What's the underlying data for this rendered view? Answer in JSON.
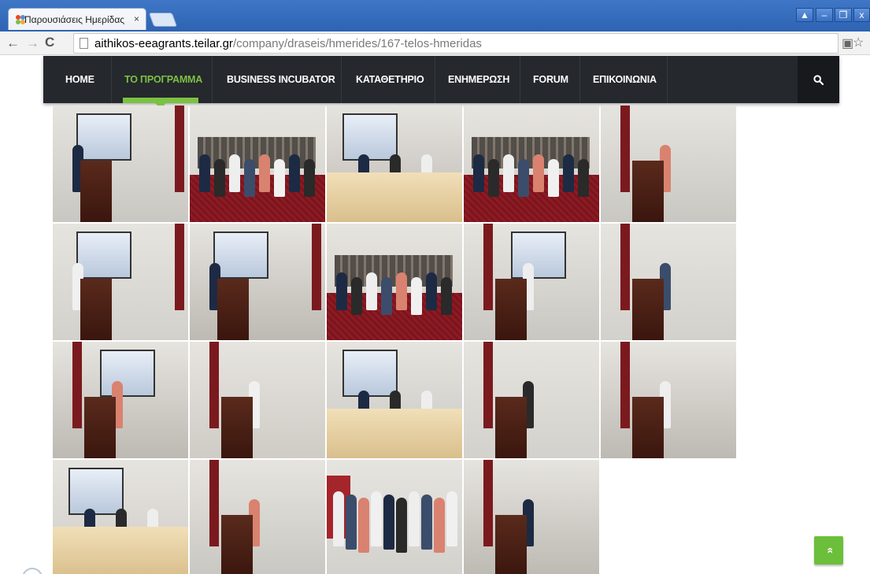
{
  "browser": {
    "tab_title": "Παρουσιάσεις Ημερίδας",
    "tab_close": "×",
    "url_host": "aithikos-eeagrants.teilar.gr",
    "url_path": "/company/draseis/hmerides/167-telos-hmeridas",
    "nav_icons": [
      "back-arrow-icon",
      "forward-arrow-icon",
      "reload-icon"
    ]
  },
  "site_nav": {
    "items": [
      {
        "label": "HOME",
        "active": false
      },
      {
        "label": "ΤΟ ΠΡΟΓΡΑΜΜΑ",
        "active": true
      },
      {
        "label": "BUSINESS INCUBATOR",
        "active": false
      },
      {
        "label": "ΚΑΤΑΘΕΤΗΡΙΟ",
        "active": false
      },
      {
        "label": "ΕΝΗΜΕΡΩΣΗ",
        "active": false
      },
      {
        "label": "FORUM",
        "active": false
      },
      {
        "label": "ΕΠΙΚΟΙΝΩΝΙΑ",
        "active": false
      }
    ],
    "search_icon": "search-icon",
    "accent_color": "#7bc143",
    "background_color": "#25282c"
  },
  "gallery": {
    "photos": [
      {
        "scene": "speaker-screen-left"
      },
      {
        "scene": "audience"
      },
      {
        "scene": "panel-table"
      },
      {
        "scene": "audience"
      },
      {
        "scene": "speaker-right"
      },
      {
        "scene": "speaker-screen-left"
      },
      {
        "scene": "speaker-screen-left"
      },
      {
        "scene": "audience"
      },
      {
        "scene": "speaker-screen-right"
      },
      {
        "scene": "speaker-right"
      },
      {
        "scene": "speaker-screen-right"
      },
      {
        "scene": "speaker-right"
      },
      {
        "scene": "panel-table"
      },
      {
        "scene": "speaker-right"
      },
      {
        "scene": "speaker-right"
      },
      {
        "scene": "panel-table"
      },
      {
        "scene": "speaker-right"
      },
      {
        "scene": "group"
      },
      {
        "scene": "speaker-right"
      }
    ]
  },
  "back_to_top": {
    "icon": "double-chevron-up-icon",
    "label": "»",
    "color": "#6cbf3a"
  }
}
